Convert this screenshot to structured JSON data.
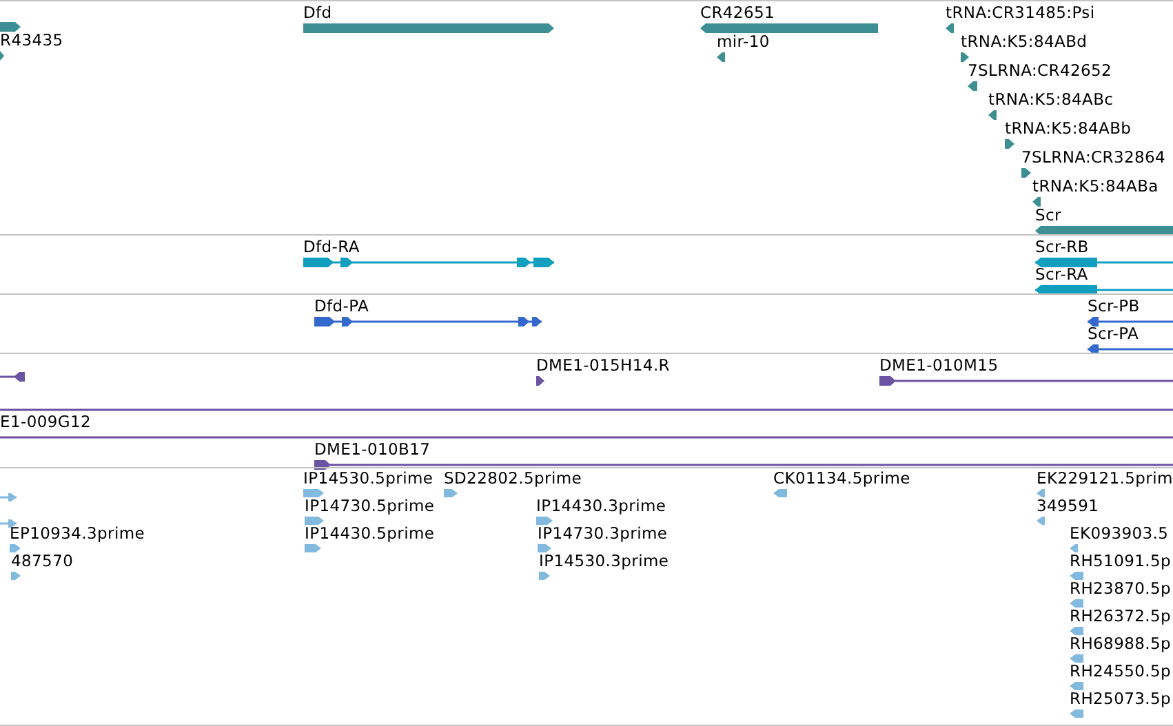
{
  "tracks": [
    {
      "kind": "gene",
      "features": [
        {
          "reverse": false
        },
        {
          "label": "R43435",
          "reverse": false
        },
        {
          "label": "Dfd",
          "reverse": false
        },
        {
          "label": "CR42651",
          "reverse": true
        },
        {
          "label": "mir-10",
          "reverse": true
        },
        {
          "label": "tRNA:CR31485:Psi",
          "reverse": true
        },
        {
          "label": "tRNA:K5:84ABd",
          "reverse": false
        },
        {
          "label": "7SLRNA:CR42652",
          "reverse": true
        },
        {
          "label": "tRNA:K5:84ABc",
          "reverse": true
        },
        {
          "label": "tRNA:K5:84ABb",
          "reverse": false
        },
        {
          "label": "7SLRNA:CR32864",
          "reverse": false
        },
        {
          "label": "tRNA:K5:84ABa",
          "reverse": true
        },
        {
          "label": "Scr",
          "reverse": true
        }
      ]
    },
    {
      "kind": "transcript",
      "features": [
        {
          "label": "Dfd-RA",
          "reverse": false
        },
        {
          "label": "Scr-RB",
          "reverse": true
        },
        {
          "label": "Scr-RA",
          "reverse": true
        }
      ]
    },
    {
      "kind": "protein",
      "features": [
        {
          "label": "Dfd-PA",
          "reverse": false
        },
        {
          "label": "Scr-PB",
          "reverse": true
        },
        {
          "label": "Scr-PA",
          "reverse": true
        }
      ]
    },
    {
      "kind": "clone",
      "features": [
        {
          "reverse": true
        },
        {
          "label": "DME1-015H14.R",
          "reverse": false
        },
        {
          "label": "DME1-010M15",
          "reverse": false
        },
        {
          "kind": "line"
        },
        {
          "label": "E1-009G12",
          "kind": "line"
        },
        {
          "label": "DME1-010B17",
          "reverse": false
        }
      ]
    },
    {
      "kind": "est",
      "features": [
        {
          "reverse": false
        },
        {
          "reverse": false
        },
        {
          "label": "EP10934.3prime",
          "reverse": false
        },
        {
          "label": "487570",
          "reverse": false
        },
        {
          "label": "IP14530.5prime",
          "reverse": false
        },
        {
          "label": "IP14730.5prime",
          "reverse": false
        },
        {
          "label": "IP14430.5prime",
          "reverse": false
        },
        {
          "label": "SD22802.5prime",
          "reverse": false
        },
        {
          "label": "IP14430.3prime",
          "reverse": false
        },
        {
          "label": "IP14730.3prime",
          "reverse": false
        },
        {
          "label": "IP14530.3prime",
          "reverse": false
        },
        {
          "label": "CK01134.5prime",
          "reverse": true
        },
        {
          "label": "EK229121.5prim",
          "reverse": true
        },
        {
          "label": "349591",
          "reverse": true
        },
        {
          "label": "EK093903.5",
          "reverse": true
        },
        {
          "label": "RH51091.5p",
          "reverse": true
        },
        {
          "label": "RH23870.5p",
          "reverse": true
        },
        {
          "label": "RH26372.5p",
          "reverse": true
        },
        {
          "label": "RH68988.5p",
          "reverse": true
        },
        {
          "label": "RH24550.5p",
          "reverse": true
        },
        {
          "label": "RH25073.5p",
          "reverse": true
        }
      ]
    }
  ]
}
